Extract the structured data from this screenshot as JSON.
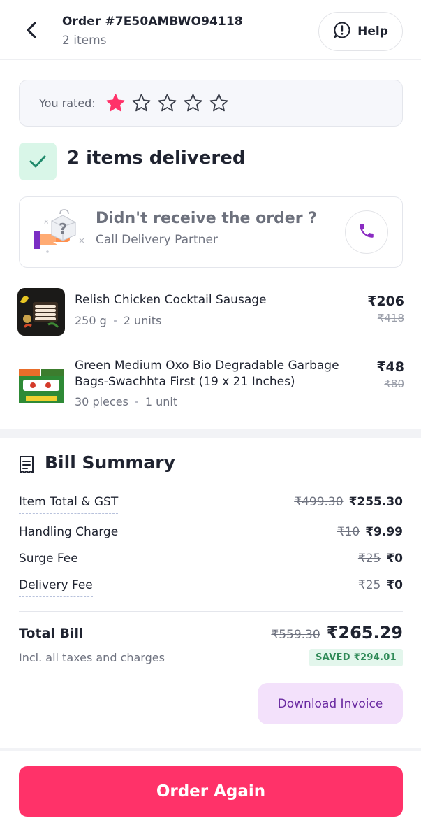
{
  "header": {
    "order_id": "Order #7E50AMBWO94118",
    "items_count": "2 items",
    "help_label": "Help",
    "back_icon": "back-arrow-icon",
    "help_icon": "chat-help-icon"
  },
  "rating": {
    "label": "You rated:",
    "value": 1,
    "max": 5,
    "filled_color": "#ff3269"
  },
  "delivery": {
    "status_text": "2 items delivered",
    "status_icon": "check-icon",
    "status_color": "#d9f6e8"
  },
  "not_received": {
    "title": "Didn't receive the order ?",
    "subtitle": "Call Delivery Partner",
    "call_icon": "phone-icon"
  },
  "items": [
    {
      "name": "Relish Chicken Cocktail Sausage",
      "qty": "250 g",
      "units": "2 units",
      "price": "₹206",
      "mrp": "₹418"
    },
    {
      "name": "Green Medium Oxo Bio Degradable Garbage Bags-Swachhta First (19 x 21 Inches)",
      "qty": "30 pieces",
      "units": "1 unit",
      "price": "₹48",
      "mrp": "₹80"
    }
  ],
  "bill": {
    "title": "Bill Summary",
    "rows": [
      {
        "label": "Item Total & GST",
        "original": "₹499.30",
        "value": "₹255.30"
      },
      {
        "label": "Handling Charge",
        "original": "₹10",
        "value": "₹9.99"
      },
      {
        "label": "Surge Fee",
        "original": "₹25",
        "value": "₹0"
      },
      {
        "label": "Delivery Fee",
        "original": "₹25",
        "value": "₹0"
      }
    ],
    "total_label": "Total Bill",
    "total_original": "₹559.30",
    "total_value": "₹265.29",
    "total_sub": "Incl. all taxes and charges",
    "saved": "SAVED ₹294.01",
    "download_label": "Download Invoice"
  },
  "footer": {
    "order_again_label": "Order Again"
  }
}
